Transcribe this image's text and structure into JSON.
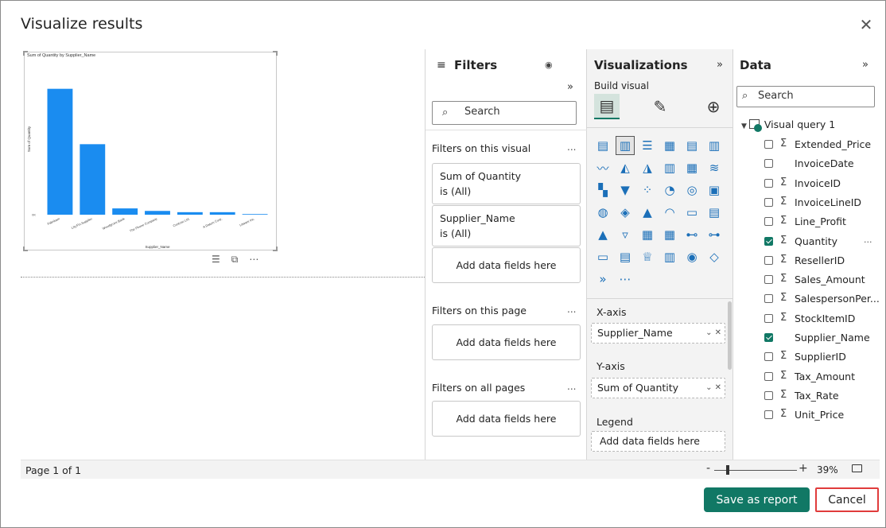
{
  "dialog": {
    "title": "Visualize results",
    "close_icon": "close-icon"
  },
  "chart_data": {
    "type": "bar",
    "title": "Sum of Quantity by Supplier_Name",
    "xlabel": "Supplier_Name",
    "ylabel": "Sum of Quantity",
    "categories": [
      "Fabrikam",
      "Lity.Fin.Supplier",
      "Woodgrove Bank",
      "The Phone Company",
      "Contoso Ltd.",
      "A Datum Corp.",
      "Litware Inc."
    ],
    "values": [
      100,
      56,
      5,
      3,
      2,
      2,
      0.5
    ],
    "ylim": [
      0,
      120
    ],
    "color": "#1a8cf0"
  },
  "visual_toolbar": {
    "filter_icon": "filter-icon",
    "focus_icon": "focus-mode-icon",
    "more_icon": "more-options-icon"
  },
  "filters": {
    "title": "Filters",
    "search_placeholder": "Search",
    "on_visual_label": "Filters on this visual",
    "visual_cards": [
      {
        "field": "Sum of Quantity",
        "state": "is (All)"
      },
      {
        "field": "Supplier_Name",
        "state": "is (All)"
      }
    ],
    "add_fields": "Add data fields here",
    "on_page_label": "Filters on this page",
    "on_all_pages_label": "Filters on all pages",
    "more": "..."
  },
  "visualizations": {
    "title": "Visualizations",
    "build_label": "Build visual",
    "more": "...",
    "wells": {
      "x_label": "X-axis",
      "x_field": "Supplier_Name",
      "y_label": "Y-axis",
      "y_field": "Sum of Quantity",
      "legend_label": "Legend",
      "legend_placeholder": "Add data fields here"
    }
  },
  "data": {
    "title": "Data",
    "search_placeholder": "Search",
    "table_name": "Visual query 1",
    "fields": [
      {
        "name": "Extended_Price",
        "sigma": true,
        "checked": false
      },
      {
        "name": "InvoiceDate",
        "sigma": false,
        "checked": false
      },
      {
        "name": "InvoiceID",
        "sigma": true,
        "checked": false
      },
      {
        "name": "InvoiceLineID",
        "sigma": true,
        "checked": false
      },
      {
        "name": "Line_Profit",
        "sigma": true,
        "checked": false
      },
      {
        "name": "Quantity",
        "sigma": true,
        "checked": true
      },
      {
        "name": "ResellerID",
        "sigma": true,
        "checked": false
      },
      {
        "name": "Sales_Amount",
        "sigma": true,
        "checked": false
      },
      {
        "name": "SalespersonPer...",
        "sigma": true,
        "checked": false
      },
      {
        "name": "StockItemID",
        "sigma": true,
        "checked": false
      },
      {
        "name": "Supplier_Name",
        "sigma": false,
        "checked": true
      },
      {
        "name": "SupplierID",
        "sigma": true,
        "checked": false
      },
      {
        "name": "Tax_Amount",
        "sigma": true,
        "checked": false
      },
      {
        "name": "Tax_Rate",
        "sigma": true,
        "checked": false
      },
      {
        "name": "Unit_Price",
        "sigma": true,
        "checked": false
      }
    ],
    "row_more": "..."
  },
  "status": {
    "page": "Page 1 of 1",
    "zoom": "39%",
    "zoom_minus": "-",
    "zoom_plus": "+",
    "zoom_fraction": 0.14
  },
  "footer": {
    "save": "Save as report",
    "cancel": "Cancel"
  },
  "colors": {
    "accent": "#117865",
    "bar": "#1a8cf0",
    "cancel_border": "#e03c3c"
  }
}
